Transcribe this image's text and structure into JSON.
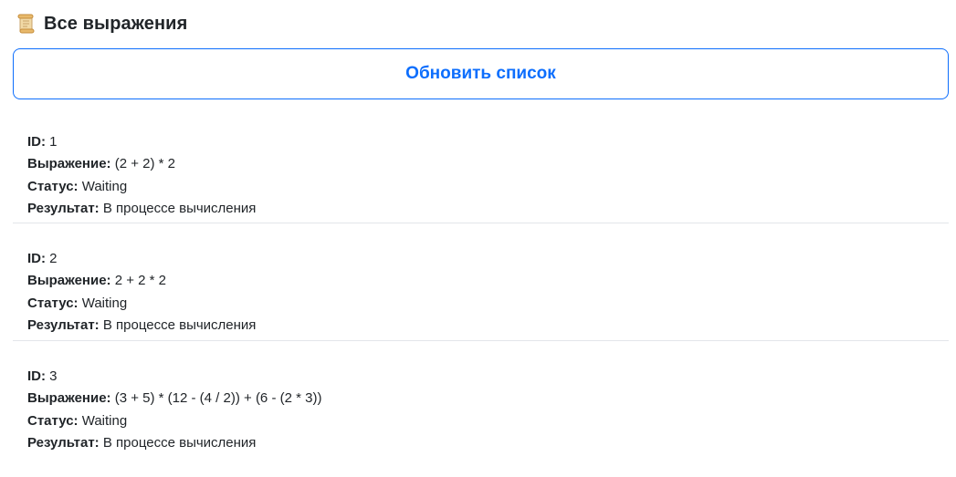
{
  "header": {
    "icon": "scroll-icon",
    "title": "Все выражения"
  },
  "refresh_button": {
    "label": "Обновить список"
  },
  "labels": {
    "id": "ID:",
    "expression": "Выражение:",
    "status": "Статус:",
    "result": "Результат:"
  },
  "expressions": [
    {
      "id": "1",
      "expression": "(2 + 2) * 2",
      "status": "Waiting",
      "result": "В процессе вычисления"
    },
    {
      "id": "2",
      "expression": "2 + 2 * 2",
      "status": "Waiting",
      "result": "В процессе вычисления"
    },
    {
      "id": "3",
      "expression": "(3 + 5) * (12 - (4 / 2)) + (6 - (2 * 3))",
      "status": "Waiting",
      "result": "В процессе вычисления"
    }
  ],
  "colors": {
    "accent": "#0d6efd",
    "divider": "#e3e6ea"
  }
}
